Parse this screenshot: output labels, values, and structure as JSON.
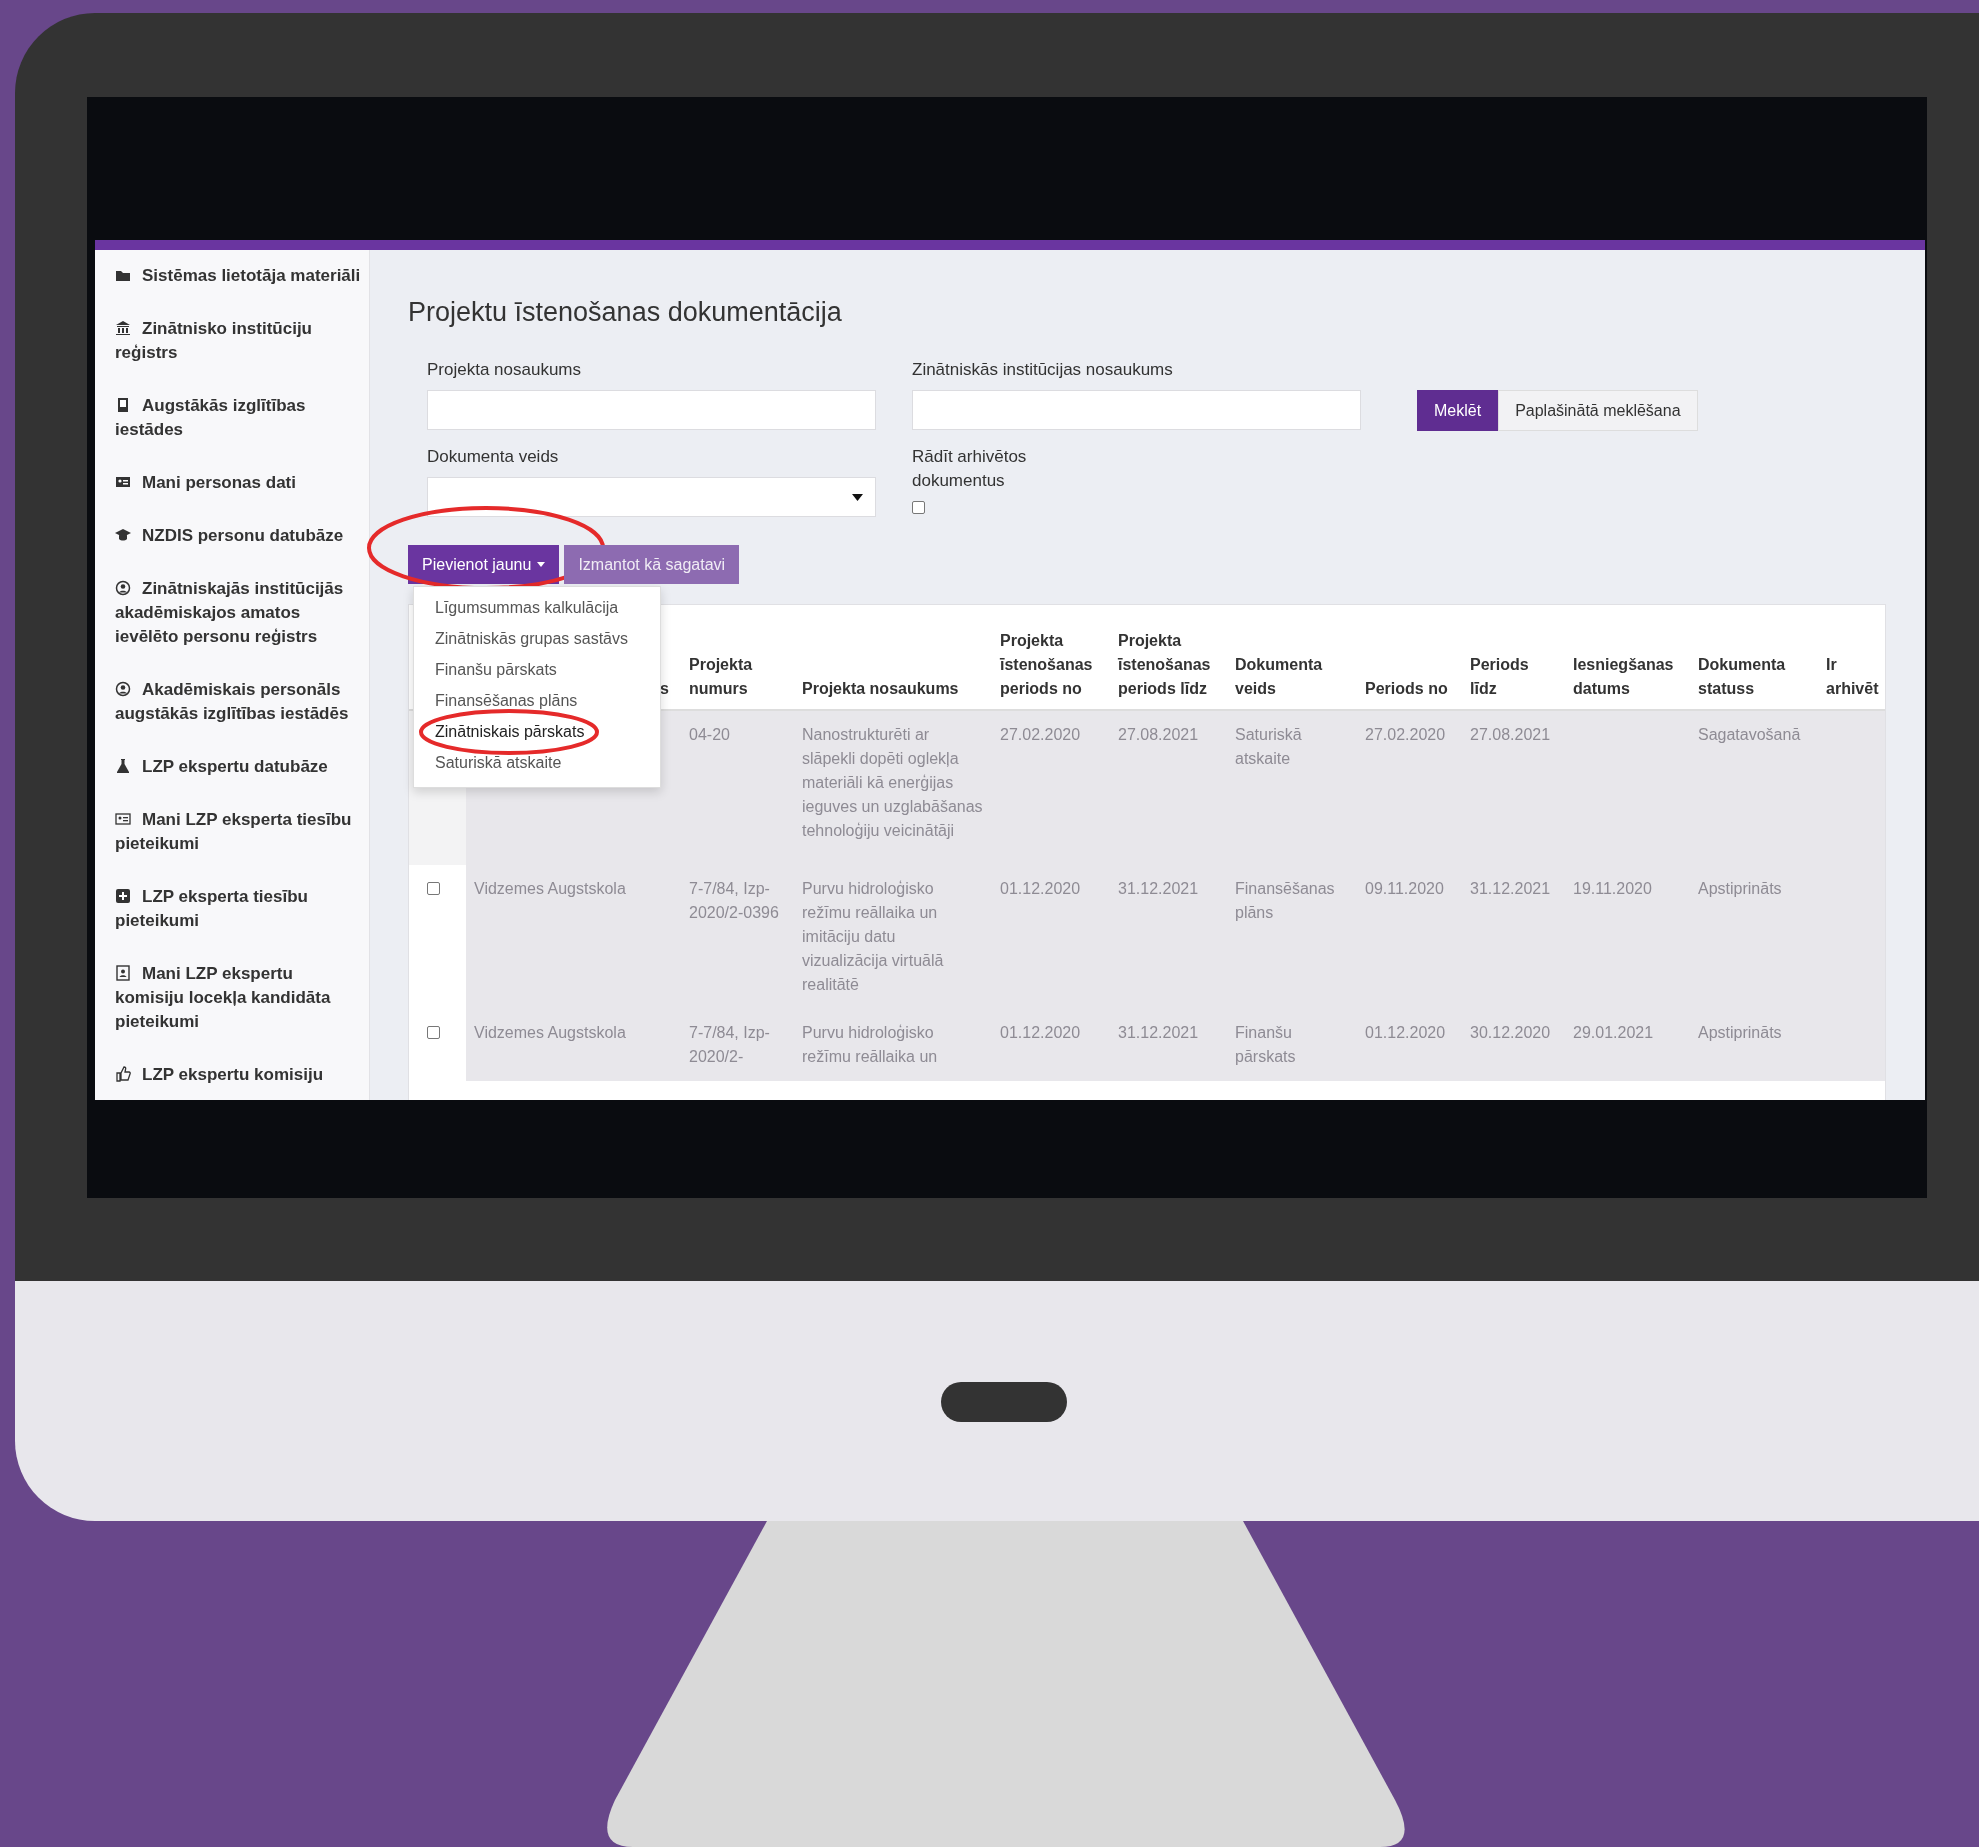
{
  "sidebar": {
    "items": [
      {
        "label": "Sistēmas lietotāja materiāli"
      },
      {
        "label": "Zinātnisko institūciju reģistrs"
      },
      {
        "label": "Augstākās izglītības iestādes"
      },
      {
        "label": "Mani personas dati"
      },
      {
        "label": "NZDIS personu datubāze"
      },
      {
        "label": "Zinātniskajās institūcijās akadēmiskajos amatos ievēlēto personu reģistrs"
      },
      {
        "label": "Akadēmiskais personāls augstākās izglītības iestādēs"
      },
      {
        "label": "LZP ekspertu datubāze"
      },
      {
        "label": "Mani LZP eksperta tiesību pieteikumi"
      },
      {
        "label": "LZP eksperta tiesību pieteikumi"
      },
      {
        "label": "Mani LZP ekspertu komisiju locekļa kandidāta pieteikumi"
      },
      {
        "label": "LZP ekspertu komisiju"
      }
    ]
  },
  "title": "Projektu īstenošanas dokumentācija",
  "filters": {
    "project_name": {
      "label": "Projekta nosaukums"
    },
    "institution_name": {
      "label": "Zinātniskās institūcijas nosaukums"
    },
    "document_type": {
      "label": "Dokumenta veids"
    },
    "show_archived": {
      "label": "Rādīt arhivētos dokumentus",
      "checked": false
    }
  },
  "search_buttons": [
    {
      "label": "Meklēt",
      "kind": "primary"
    },
    {
      "label": "Paplašinātā meklēšana",
      "kind": "default"
    }
  ],
  "actions": [
    {
      "label": "Pievienot jaunu",
      "disabled": false,
      "highlighted": true
    },
    {
      "label": "Izmantot kā sagatavi",
      "disabled": true,
      "highlighted": false
    }
  ],
  "dropdown_menu": {
    "items": [
      {
        "label": "Līgumsummas kalkulācija",
        "highlighted": false
      },
      {
        "label": "Zinātniskās grupas sastāvs",
        "highlighted": false
      },
      {
        "label": "Finanšu pārskats",
        "highlighted": false
      },
      {
        "label": "Finansēšanas plāns",
        "highlighted": false
      },
      {
        "label": "Zinātniskais pārskats",
        "highlighted": true
      },
      {
        "label": "Saturiskā atskaite",
        "highlighted": false
      }
    ]
  },
  "table": {
    "columns": [
      "s",
      "Projekta numurs",
      "Projekta nosaukums",
      "Projekta īstenošanas periods no",
      "Projekta īstenošanas periods līdz",
      "Dokumenta veids",
      "Periods no",
      "Periods līdz",
      "Iesniegšanas datums",
      "Dokumenta statuss",
      "Ir arhivēt"
    ],
    "rows": [
      {
        "cells": [
          null,
          "04-20",
          "Nanostrukturēti ar slāpekli dopēti oglekļa materiāli kā enerģijas ieguves un uzglabāšanas tehnoloģiju veicinātāji",
          "27.02.2020",
          "27.08.2021",
          "Saturiskā atskaite",
          "27.02.2020",
          "27.08.2021",
          null,
          "Sagatavošanā"
        ]
      },
      {
        "checked": false,
        "cells": [
          "Vidzemes Augstskola",
          "7-7/84, Izp-2020/2-0396",
          "Purvu hidroloģisko režīmu reāllaika un imitāciju datu vizualizācija virtuālā realitātē",
          "01.12.2020",
          "31.12.2021",
          "Finansēšanas plāns",
          "09.11.2020",
          "31.12.2021",
          "19.11.2020",
          "Apstiprināts"
        ]
      },
      {
        "checked": false,
        "cells": [
          "Vidzemes Augstskola",
          "7-7/84, Izp-2020/2-",
          "Purvu hidroloģisko režīmu reāllaika un",
          "01.12.2020",
          "31.12.2021",
          "Finanšu pārskats",
          "01.12.2020",
          "30.12.2020",
          "29.01.2021",
          "Apstiprināts"
        ]
      }
    ]
  }
}
